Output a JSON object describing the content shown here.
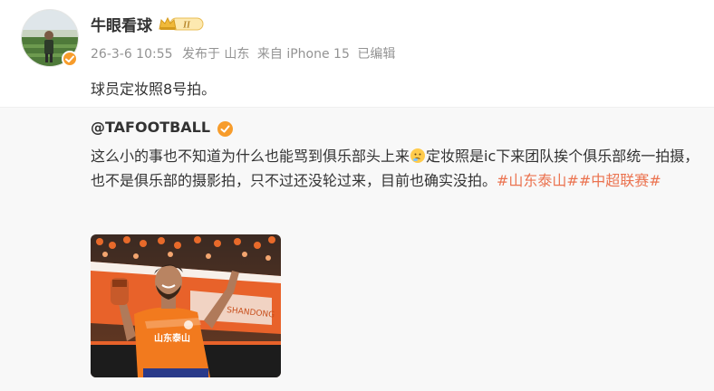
{
  "author": {
    "name": "牛眼看球",
    "verified": true,
    "vip_level": "II"
  },
  "meta": {
    "date": "26-3-6 10:55",
    "location": "发布于 山东",
    "source": "来自 iPhone 15",
    "edited": "已编辑"
  },
  "post": {
    "text": "球员定妆照8号拍。"
  },
  "repost": {
    "author": "@TAFOOTBALL",
    "verified": true,
    "text_part1": "这么小的事也不知道为什么也能骂到俱乐部头上来",
    "text_part2": "定妆照是ic下来团队挨个俱乐部统一拍摄，也不是俱乐部的摄影拍，只不过还没轮过来，目前也确实没拍。",
    "hashtag1": "#山东泰山#",
    "hashtag2": "#中超联赛#",
    "image": {
      "jersey_text": "山东泰山"
    }
  },
  "colors": {
    "accent_orange": "#f79c2b",
    "hashtag": "#eb7350",
    "meta_gray": "#939393",
    "repost_bg": "#f8f8f8"
  }
}
